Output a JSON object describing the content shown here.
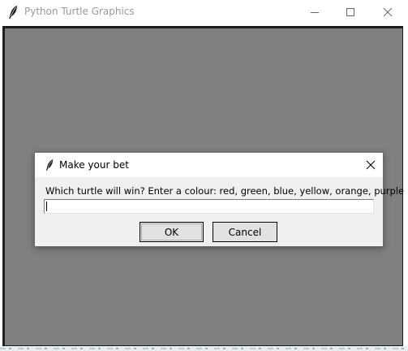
{
  "window": {
    "title": "Python Turtle Graphics",
    "icon": "feather-icon",
    "controls": [
      "minimize-icon",
      "maximize-icon",
      "close-icon"
    ],
    "canvas_color": "#808080"
  },
  "dialog": {
    "title": "Make your bet",
    "icon": "feather-icon",
    "prompt": "Which turtle will win? Enter a colour: red, green, blue, yellow, orange, purple",
    "input_value": "",
    "ok_label": "OK",
    "cancel_label": "Cancel"
  }
}
